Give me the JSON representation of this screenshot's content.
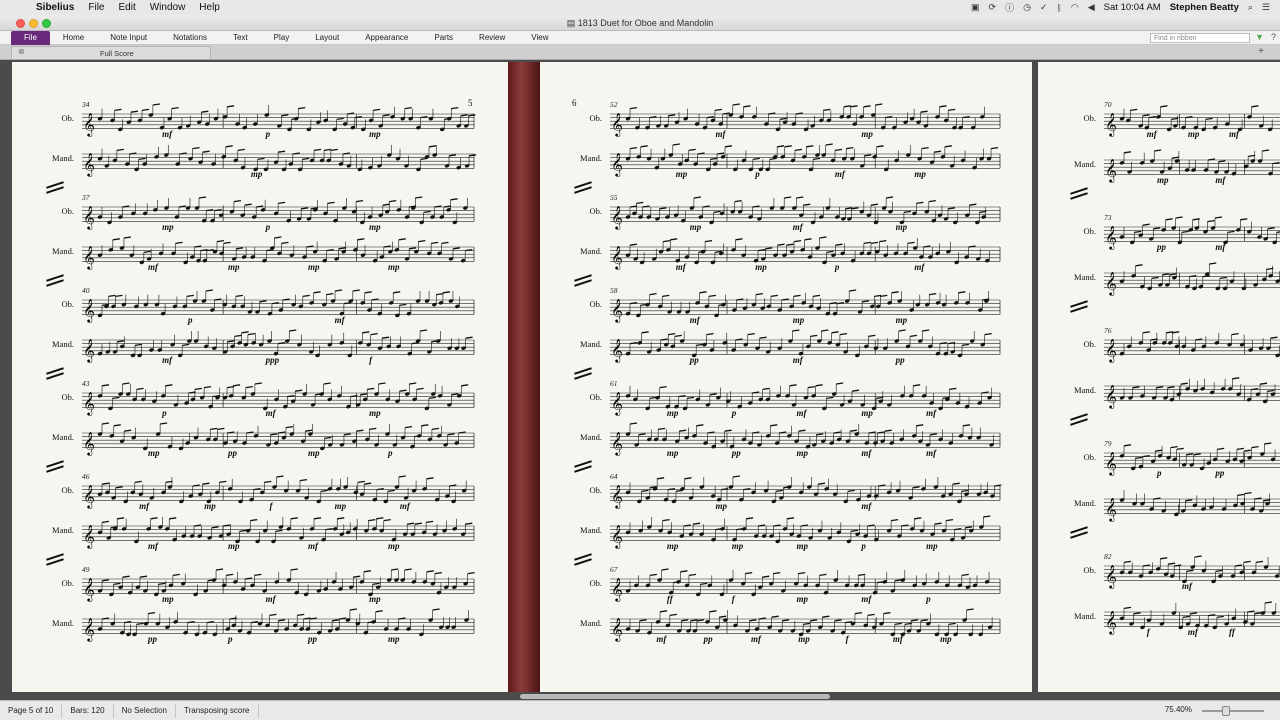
{
  "menubar": {
    "app": "Sibelius",
    "items": [
      "File",
      "Edit",
      "Window",
      "Help"
    ],
    "clock": "Sat 10:04 AM",
    "user": "Stephen Beatty"
  },
  "window": {
    "title": "1813 Duet for Oboe and Mandolin"
  },
  "ribbon": {
    "tabs": [
      "File",
      "Home",
      "Note Input",
      "Notations",
      "Text",
      "Play",
      "Layout",
      "Appearance",
      "Parts",
      "Review",
      "View"
    ],
    "search_placeholder": "Find in ribbon"
  },
  "doc_tab": {
    "label": "Full Score"
  },
  "instruments": {
    "oboe": "Ob.",
    "mandolin": "Mand."
  },
  "pages": [
    {
      "page_number": "5",
      "systems": [
        {
          "bar": "34",
          "ob_dyn": [
            "mf",
            "p",
            "mp"
          ],
          "mand_dyn": [
            "mp"
          ]
        },
        {
          "bar": "37",
          "ob_dyn": [
            "mp",
            "p",
            "mp"
          ],
          "mand_dyn": [
            "mf",
            "mp",
            "mp",
            "mp"
          ]
        },
        {
          "bar": "40",
          "ob_dyn": [
            "p",
            "mf"
          ],
          "mand_dyn": [
            "mf",
            "ppp",
            "f"
          ]
        },
        {
          "bar": "43",
          "ob_dyn": [
            "p",
            "mf",
            "mp"
          ],
          "mand_dyn": [
            "mp",
            "pp",
            "mp",
            "p"
          ]
        },
        {
          "bar": "46",
          "ob_dyn": [
            "mf",
            "mp",
            "f",
            "mp",
            "mf"
          ],
          "mand_dyn": [
            "mf",
            "mp",
            "mf",
            "mp"
          ]
        },
        {
          "bar": "49",
          "ob_dyn": [
            "mp",
            "mf",
            "mp"
          ],
          "mand_dyn": [
            "pp",
            "p",
            "pp",
            "mp"
          ]
        }
      ]
    },
    {
      "page_number": "6",
      "systems": [
        {
          "bar": "52",
          "ob_dyn": [
            "mf",
            "mp"
          ],
          "mand_dyn": [
            "mp",
            "p",
            "mf",
            "mp"
          ]
        },
        {
          "bar": "55",
          "ob_dyn": [
            "mp",
            "mf",
            "mp"
          ],
          "mand_dyn": [
            "mf",
            "mp",
            "p",
            "mf"
          ]
        },
        {
          "bar": "58",
          "ob_dyn": [
            "mf",
            "mp",
            "mp"
          ],
          "mand_dyn": [
            "pp",
            "mf",
            "pp"
          ]
        },
        {
          "bar": "61",
          "ob_dyn": [
            "mp",
            "p",
            "mf",
            "mp",
            "mf"
          ],
          "mand_dyn": [
            "mp",
            "pp",
            "mp",
            "mf",
            "mf"
          ]
        },
        {
          "bar": "64",
          "ob_dyn": [
            "mp",
            "mf"
          ],
          "mand_dyn": [
            "mp",
            "mp",
            "mp",
            "p",
            "mp"
          ]
        },
        {
          "bar": "67",
          "ob_dyn": [
            "ff",
            "f",
            "mp",
            "mf",
            "p"
          ],
          "mand_dyn": [
            "mf",
            "pp",
            "mf",
            "mp",
            "f",
            "mf",
            "mp"
          ]
        }
      ]
    },
    {
      "page_number": "",
      "systems": [
        {
          "bar": "70",
          "ob_dyn": [
            "mf",
            "mp",
            "mf"
          ],
          "mand_dyn": [
            "mp",
            "mf"
          ]
        },
        {
          "bar": "73",
          "ob_dyn": [
            "pp",
            "mf"
          ],
          "mand_dyn": []
        },
        {
          "bar": "76",
          "ob_dyn": [],
          "mand_dyn": []
        },
        {
          "bar": "79",
          "ob_dyn": [
            "p",
            "pp"
          ],
          "mand_dyn": []
        },
        {
          "bar": "82",
          "ob_dyn": [
            "mf"
          ],
          "mand_dyn": [
            "f",
            "mf",
            "ff"
          ]
        }
      ]
    }
  ],
  "status": {
    "page": "Page 5 of 10",
    "bars": "Bars: 120",
    "selection": "No Selection",
    "mode": "Transposing score",
    "zoom": "75.40%"
  }
}
